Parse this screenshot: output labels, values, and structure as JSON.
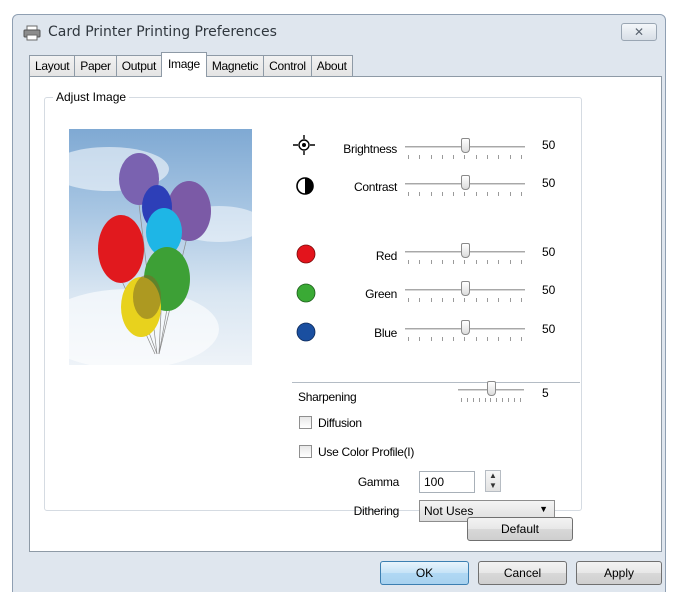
{
  "window": {
    "title": "Card Printer Printing Preferences",
    "close_label": "✕"
  },
  "tabs": [
    {
      "label": "Layout"
    },
    {
      "label": "Paper"
    },
    {
      "label": "Output"
    },
    {
      "label": "Image",
      "active": true
    },
    {
      "label": "Magnetic"
    },
    {
      "label": "Control"
    },
    {
      "label": "About"
    }
  ],
  "group": {
    "title": "Adjust Image"
  },
  "sliders": [
    {
      "id": "brightness",
      "label": "Brightness",
      "value": "50",
      "level": 0.5,
      "icon": "sun-icon"
    },
    {
      "id": "contrast",
      "label": "Contrast",
      "value": "50",
      "level": 0.5,
      "icon": "contrast-icon"
    },
    {
      "id": "red",
      "label": "Red",
      "value": "50",
      "level": 0.5,
      "icon": "color-dot-icon",
      "color": "#e3141c"
    },
    {
      "id": "green",
      "label": "Green",
      "value": "50",
      "level": 0.5,
      "icon": "color-dot-icon",
      "color": "#3aaa35"
    },
    {
      "id": "blue",
      "label": "Blue",
      "value": "50",
      "level": 0.5,
      "icon": "color-dot-icon",
      "color": "#1a4fa0"
    }
  ],
  "sharpening": {
    "label": "Sharpening",
    "value": "5",
    "level": 0.5
  },
  "diffusion": {
    "label": "Diffusion",
    "checked": false
  },
  "color_profile": {
    "label": "Use Color Profile(I)",
    "checked": false
  },
  "gamma": {
    "label": "Gamma",
    "value": "100"
  },
  "dithering": {
    "label": "Dithering",
    "selected": "Not Uses"
  },
  "buttons": {
    "default": "Default",
    "ok": "OK",
    "cancel": "Cancel",
    "apply": "Apply"
  }
}
